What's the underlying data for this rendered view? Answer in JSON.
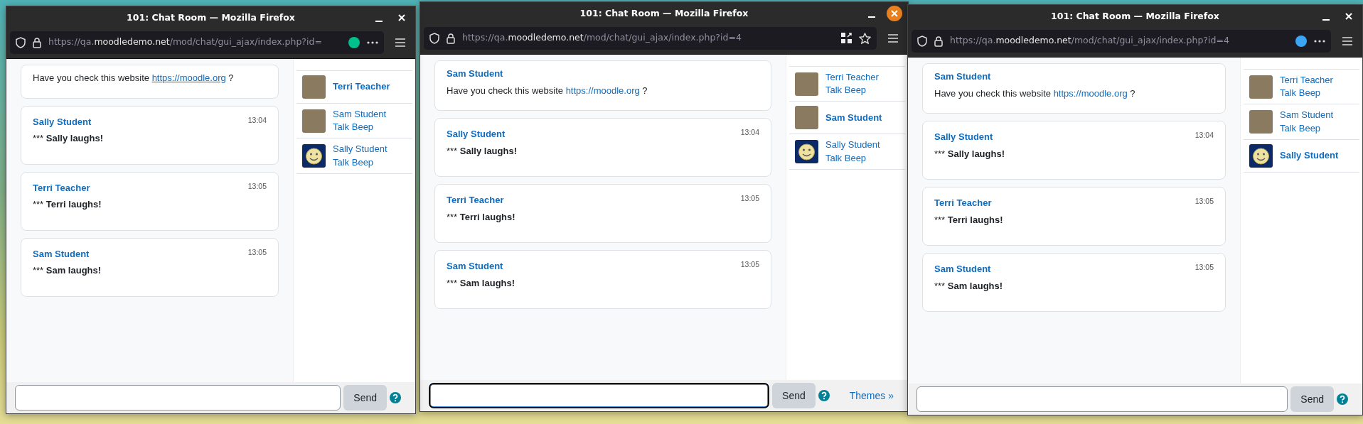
{
  "windows": [
    {
      "title": "101: Chat Room — Mozilla Firefox",
      "focused": false,
      "url": {
        "scheme": "https://qa.",
        "host": "moodledemo.net",
        "path": "/mod/chat/gui_ajax/index.php?id="
      },
      "page_actions": [
        {
          "kind": "dot",
          "color": "#00c08b"
        },
        {
          "kind": "more"
        }
      ],
      "messages": [
        {
          "kind": "text",
          "text": "Have you check this website",
          "link": "https://moodle.org",
          "after": "?"
        },
        {
          "kind": "action",
          "author": "Sally Student",
          "time": "13:04",
          "prefix": "***",
          "text": "Sally laughs!"
        },
        {
          "kind": "action",
          "author": "Terri Teacher",
          "time": "13:05",
          "prefix": "***",
          "text": "Terri laughs!"
        },
        {
          "kind": "action",
          "author": "Sam Student",
          "time": "13:05",
          "prefix": "***",
          "text": "Sam laughs!"
        }
      ],
      "users": [
        {
          "name": "Terri Teacher",
          "kind": "photo",
          "current": true
        },
        {
          "name": "Sam Student",
          "kind": "photo",
          "current": false,
          "beep": "Talk Beep"
        },
        {
          "name": "Sally Student",
          "kind": "smiley",
          "current": false,
          "beep": "Talk Beep"
        }
      ],
      "input": {
        "focused": false
      },
      "send": "Send"
    },
    {
      "title": "101: Chat Room — Mozilla Firefox",
      "focused": true,
      "url": {
        "scheme": "https://qa.",
        "host": "moodledemo.net",
        "path": "/mod/chat/gui_ajax/index.php?id=4"
      },
      "page_actions": [
        {
          "kind": "grid"
        },
        {
          "kind": "star"
        }
      ],
      "messages": [
        {
          "kind": "text",
          "author": "Sam Student",
          "text": "Have you check this website",
          "link": "https://moodle.org",
          "after": "?"
        },
        {
          "kind": "action",
          "author": "Sally Student",
          "time": "13:04",
          "prefix": "***",
          "text": "Sally laughs!"
        },
        {
          "kind": "action",
          "author": "Terri Teacher",
          "time": "13:05",
          "prefix": "***",
          "text": "Terri laughs!"
        },
        {
          "kind": "action",
          "author": "Sam Student",
          "time": "13:05",
          "prefix": "***",
          "text": "Sam laughs!"
        }
      ],
      "users": [
        {
          "name": "Terri Teacher",
          "kind": "photo",
          "current": false,
          "beep": "Talk Beep"
        },
        {
          "name": "Sam Student",
          "kind": "photo",
          "current": true
        },
        {
          "name": "Sally Student",
          "kind": "smiley",
          "current": false,
          "beep": "Talk Beep"
        }
      ],
      "input": {
        "focused": true
      },
      "send": "Send",
      "themes_link": "Themes »"
    },
    {
      "title": "101: Chat Room — Mozilla Firefox",
      "focused": false,
      "url": {
        "scheme": "https://qa.",
        "host": "moodledemo.net",
        "path": "/mod/chat/gui_ajax/index.php?id=4"
      },
      "page_actions": [
        {
          "kind": "dot",
          "color": "#3aa6f5"
        },
        {
          "kind": "more"
        }
      ],
      "messages": [
        {
          "kind": "text",
          "author": "Sam Student",
          "text": "Have you check this website",
          "link": "https://moodle.org",
          "after": "?"
        },
        {
          "kind": "action",
          "author": "Sally Student",
          "time": "13:04",
          "prefix": "***",
          "text": "Sally laughs!"
        },
        {
          "kind": "action",
          "author": "Terri Teacher",
          "time": "13:05",
          "prefix": "***",
          "text": "Terri laughs!"
        },
        {
          "kind": "action",
          "author": "Sam Student",
          "time": "13:05",
          "prefix": "***",
          "text": "Sam laughs!"
        }
      ],
      "users": [
        {
          "name": "Terri Teacher",
          "kind": "photo",
          "current": false,
          "beep": "Talk Beep"
        },
        {
          "name": "Sam Student",
          "kind": "photo",
          "current": false,
          "beep": "Talk Beep"
        },
        {
          "name": "Sally Student",
          "kind": "smiley",
          "current": true
        }
      ],
      "input": {
        "focused": false
      },
      "send": "Send"
    }
  ]
}
